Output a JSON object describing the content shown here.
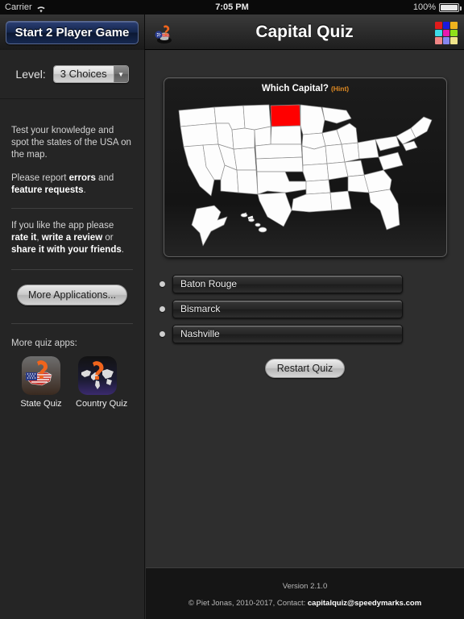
{
  "statusbar": {
    "carrier": "Carrier",
    "wifi_icon": "wifi-icon",
    "time": "7:05 PM",
    "battery_percent": "100%",
    "battery_icon": "battery-full-icon"
  },
  "navbar": {
    "start_button": "Start 2 Player Game",
    "app_icon": "usa-flag-question-icon",
    "title": "Capital Quiz",
    "grid_button_icon": "color-grid-icon",
    "grid_colors": [
      "#e01b1b",
      "#1a1ae0",
      "#f0b41e",
      "#3ddbe8",
      "#e81ab0",
      "#8fe01a",
      "#f08686",
      "#8686f0",
      "#f0e48a"
    ]
  },
  "sidebar": {
    "level": {
      "label": "Level:",
      "selected": "3 Choices",
      "arrow_icon": "chevron-down-icon"
    },
    "intro_paragraph_1": "Test your knowledge and spot the states of the USA on the map.",
    "intro_paragraph_2_prefix": "Please report ",
    "intro_paragraph_2_bold1": "errors",
    "intro_paragraph_2_mid": " and ",
    "intro_paragraph_2_bold2": "feature requests",
    "intro_paragraph_2_suffix": ".",
    "rate_prefix": "If you like the app please ",
    "rate_bold1": "rate it",
    "rate_mid1": ", ",
    "rate_bold2": "write a review",
    "rate_mid2": " or ",
    "rate_bold3": "share it with your friends",
    "rate_suffix": ".",
    "more_applications_button": "More Applications...",
    "more_quiz_apps_label": "More quiz apps:",
    "apps": [
      {
        "name": "State Quiz",
        "icon": "state-quiz-app-icon"
      },
      {
        "name": "Country Quiz",
        "icon": "country-quiz-app-icon"
      }
    ]
  },
  "quiz": {
    "question": "Which Capital?",
    "hint_label": "(Hint)",
    "highlighted_state": "North Dakota",
    "highlight_color": "#ff0000",
    "map_state_fill": "#fdfdfd",
    "map_background": "#141414",
    "options": [
      {
        "label": "Baton Rouge"
      },
      {
        "label": "Bismarck"
      },
      {
        "label": "Nashville"
      }
    ],
    "restart_button": "Restart Quiz"
  },
  "footer": {
    "version": "Version 2.1.0",
    "copyright_prefix": "© Piet Jonas, 2010-2017, Contact: ",
    "contact_email": "capitalquiz@speedymarks.com"
  }
}
